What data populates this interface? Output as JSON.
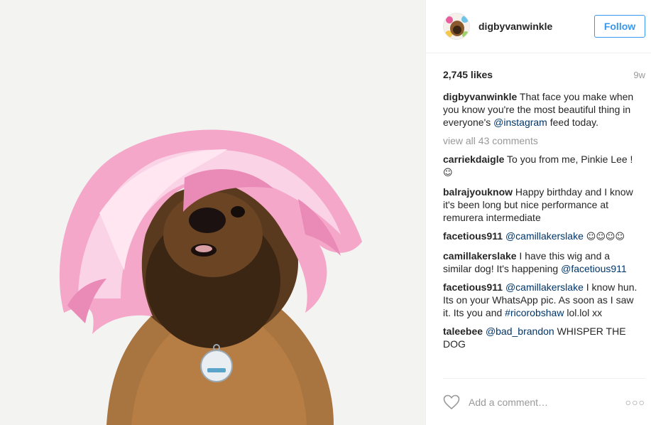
{
  "post": {
    "image_alt": "dog wearing pink wig"
  },
  "header": {
    "username": "digbyvanwinkle",
    "follow_label": "Follow"
  },
  "stats": {
    "likes": "2,745 likes",
    "age": "9w"
  },
  "caption": {
    "username": "digbyvanwinkle",
    "text_before": "That face you make when you know you're the most beautiful thing in everyone's ",
    "mention": "@instagram",
    "text_after": " feed today."
  },
  "view_all": "view all 43 comments",
  "comments": [
    {
      "username": "carriekdaigle",
      "text": "To you from me, Pinkie Lee !",
      "emoji": "☺"
    },
    {
      "username": "balrajyouknow",
      "text": "Happy birthday and I know it's been long but nice performance at remurera intermediate"
    },
    {
      "username": "facetious911",
      "mention": "@camillakerslake",
      "emoji": "☺☺☺☺"
    },
    {
      "username": "camillakerslake",
      "text": "I have this wig and a similar dog! It's happening ",
      "mention": "@facetious911"
    },
    {
      "username": "facetious911",
      "mention": "@camillakerslake",
      "text": " I know hun. Its on your WhatsApp pic. As soon as I saw it. Its you and ",
      "mention2": "#ricorobshaw",
      "text_after": " lol.lol xx"
    },
    {
      "username": "taleebee",
      "mention": "@bad_brandon",
      "text": " WHISPER THE DOG"
    }
  ],
  "add_comment": {
    "placeholder": "Add a comment…",
    "more_label": "○○○"
  },
  "icons": {
    "like": "heart-outline-icon",
    "more": "more-options-icon"
  },
  "colors": {
    "follow_blue": "#3897f0",
    "mention": "#003569",
    "muted": "#999999"
  }
}
